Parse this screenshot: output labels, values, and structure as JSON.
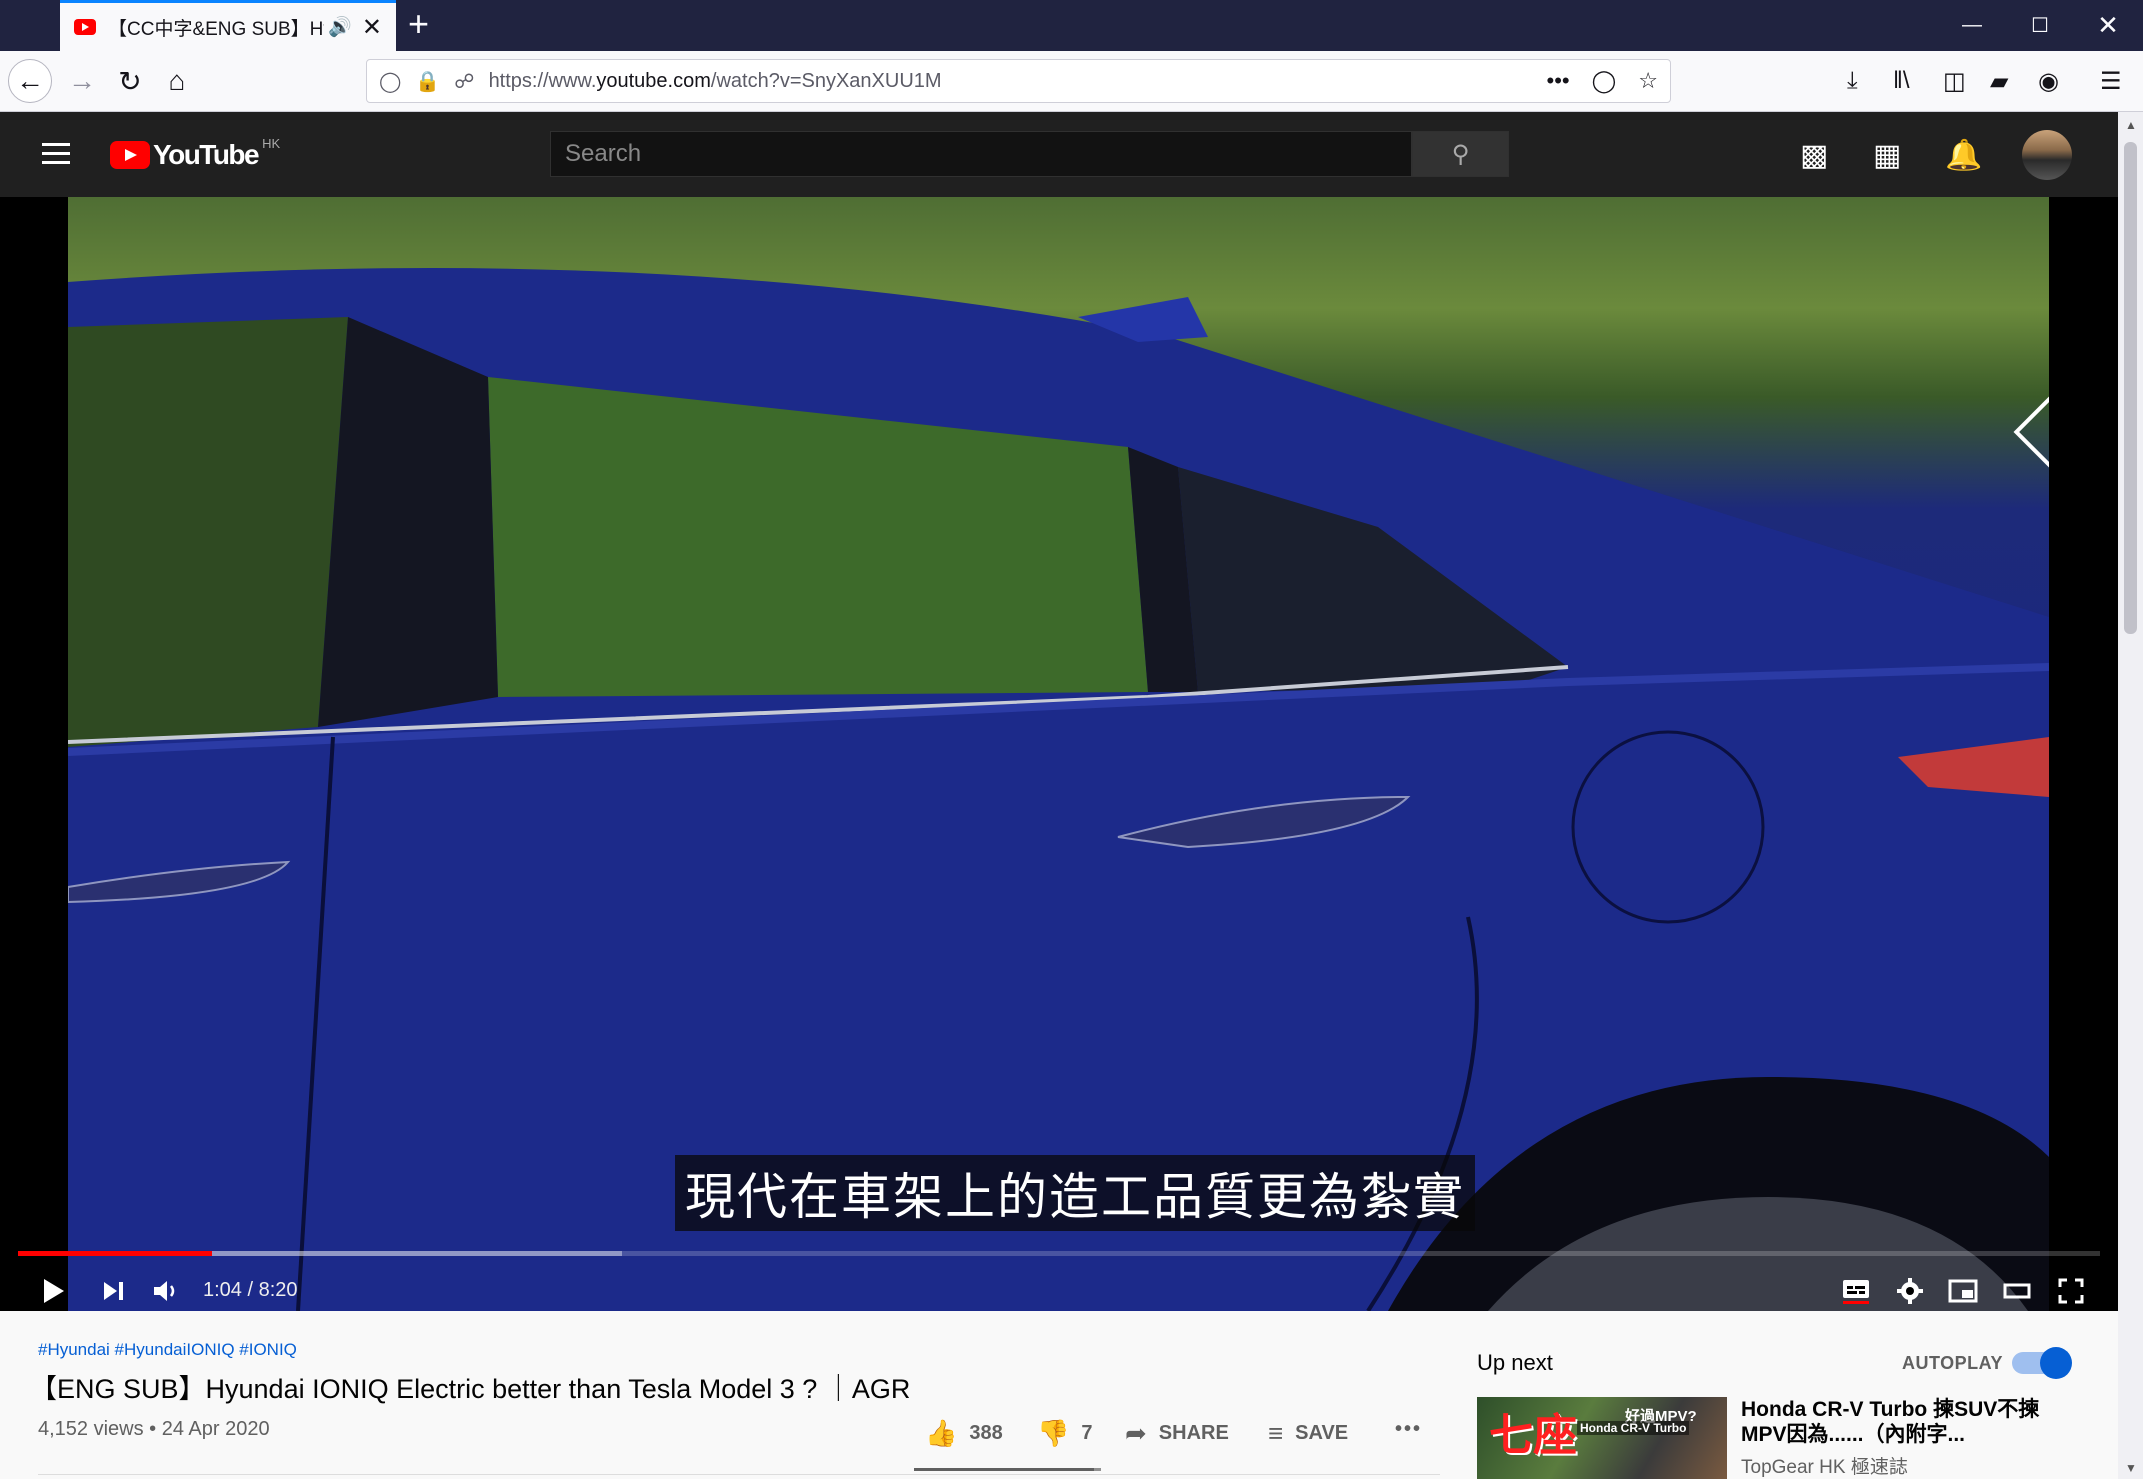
{
  "browser": {
    "tab_title": "【CC中字&ENG SUB】Hyun",
    "new_tab": "+",
    "url_prefix": "https://www.",
    "url_domain": "youtube.com",
    "url_path": "/watch?v=SnyXanXUU1M"
  },
  "youtube": {
    "logo_text": "YouTube",
    "region": "HK",
    "search_placeholder": "Search"
  },
  "player": {
    "subtitle": "現代在車架上的造工品質更為紮實",
    "time": "1:04 / 8:20",
    "progress_played_fraction": 0.093,
    "progress_loaded_fraction": 0.29
  },
  "video": {
    "tags": "#Hyundai #HyundaiIONIQ #IONIQ",
    "title": "【ENG SUB】Hyundai IONIQ Electric better than Tesla Model 3 ? ｜AGR",
    "meta": "4,152 views • 24 Apr 2020",
    "likes": "388",
    "dislikes": "7",
    "share_label": "SHARE",
    "save_label": "SAVE",
    "more": "•••"
  },
  "sidebar": {
    "upnext_label": "Up next",
    "autoplay_label": "AUTOPLAY",
    "autoplay_on": true,
    "rec": {
      "title": "Honda CR-V Turbo 揀SUV不揀MPV因為......（內附字...",
      "channel": "TopGear HK 極速誌",
      "thumb_big": "七座",
      "thumb_q": "好過MPV?",
      "thumb_small": "Honda CR-V Turbo"
    }
  }
}
